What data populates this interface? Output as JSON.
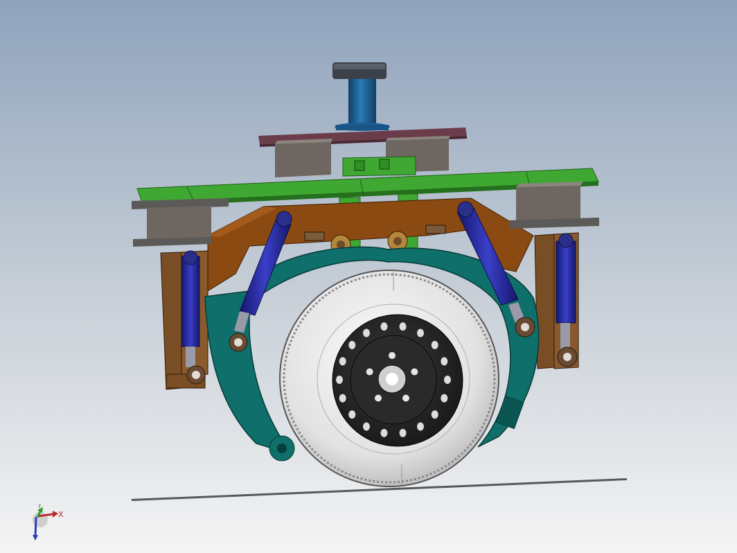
{
  "viewport": {
    "background_top": "#8FA3BC",
    "background_bottom": "#F4F4F4"
  },
  "colors": {
    "green_frame": "#2F8F24",
    "brown_arm": "#8A4A12",
    "teal_housing": "#0F6F6A",
    "navy_cylinder": "#24279A",
    "steel_blue_post": "#1C5E93",
    "maroon_plate": "#6B3C4A",
    "tire": "#D8D8D8",
    "rim": "#222222",
    "bracket_brown": "#6E4C2A",
    "bushing": "#6B4A33"
  },
  "triad": {
    "x_label": "X",
    "y_label": "Y",
    "icons": [
      "x-axis-arrow",
      "y-axis-arrow",
      "z-axis-arrow"
    ]
  }
}
